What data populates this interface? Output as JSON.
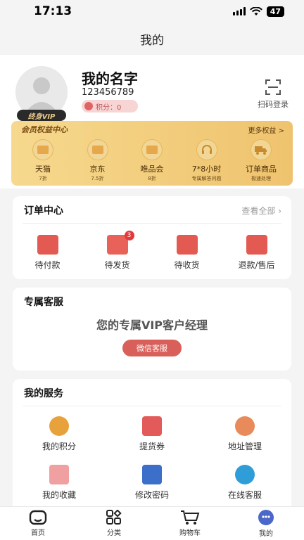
{
  "status_bar": {
    "time": "17:13",
    "battery": "47"
  },
  "nav": {
    "title": "我的"
  },
  "profile": {
    "name": "我的名字",
    "id": "123456789",
    "points": "积分：0",
    "badge": "终身VIP",
    "scan_label": "扫码登录"
  },
  "vip": {
    "title": "会员权益中心",
    "more": "更多权益 >",
    "items": [
      {
        "label": "天猫",
        "sub": "7折"
      },
      {
        "label": "京东",
        "sub": "7.5折"
      },
      {
        "label": "唯品会",
        "sub": "8折"
      },
      {
        "label": "7*8小时",
        "sub": "专属解答问题"
      },
      {
        "label": "订单商品",
        "sub": "极速处理"
      }
    ]
  },
  "orders": {
    "title": "订单中心",
    "more": "查看全部 ›",
    "items": [
      {
        "label": "待付款",
        "badge": ""
      },
      {
        "label": "待发货",
        "badge": "3"
      },
      {
        "label": "待收货",
        "badge": ""
      },
      {
        "label": "退款/售后",
        "badge": ""
      }
    ]
  },
  "exclusive_service": {
    "title": "专属客服",
    "headline": "您的专属VIP客户经理",
    "button": "微信客服"
  },
  "my_services": {
    "title": "我的服务",
    "items": [
      {
        "label": "我的积分",
        "icon": "coins-icon",
        "color": "#e8a23c"
      },
      {
        "label": "提货券",
        "icon": "coupon-icon",
        "color": "#e25a5a"
      },
      {
        "label": "地址管理",
        "icon": "location-icon",
        "color": "#e88a5a"
      },
      {
        "label": "我的收藏",
        "icon": "favorite-icon",
        "color": "#f0a0a0"
      },
      {
        "label": "修改密码",
        "icon": "password-icon",
        "color": "#3b6fc9"
      },
      {
        "label": "在线客服",
        "icon": "chat-icon",
        "color": "#2f9ed8"
      }
    ]
  },
  "tabbar": {
    "items": [
      {
        "label": "首页",
        "icon": "home-icon"
      },
      {
        "label": "分类",
        "icon": "category-icon"
      },
      {
        "label": "购物车",
        "icon": "cart-icon"
      },
      {
        "label": "我的",
        "icon": "profile-icon"
      }
    ]
  }
}
